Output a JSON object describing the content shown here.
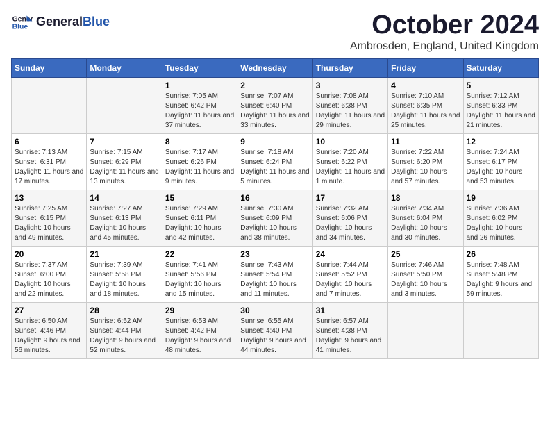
{
  "logo": {
    "line1": "General",
    "line2": "Blue"
  },
  "title": "October 2024",
  "location": "Ambrosden, England, United Kingdom",
  "headers": [
    "Sunday",
    "Monday",
    "Tuesday",
    "Wednesday",
    "Thursday",
    "Friday",
    "Saturday"
  ],
  "weeks": [
    [
      {
        "day": "",
        "info": ""
      },
      {
        "day": "",
        "info": ""
      },
      {
        "day": "1",
        "info": "Sunrise: 7:05 AM\nSunset: 6:42 PM\nDaylight: 11 hours and 37 minutes."
      },
      {
        "day": "2",
        "info": "Sunrise: 7:07 AM\nSunset: 6:40 PM\nDaylight: 11 hours and 33 minutes."
      },
      {
        "day": "3",
        "info": "Sunrise: 7:08 AM\nSunset: 6:38 PM\nDaylight: 11 hours and 29 minutes."
      },
      {
        "day": "4",
        "info": "Sunrise: 7:10 AM\nSunset: 6:35 PM\nDaylight: 11 hours and 25 minutes."
      },
      {
        "day": "5",
        "info": "Sunrise: 7:12 AM\nSunset: 6:33 PM\nDaylight: 11 hours and 21 minutes."
      }
    ],
    [
      {
        "day": "6",
        "info": "Sunrise: 7:13 AM\nSunset: 6:31 PM\nDaylight: 11 hours and 17 minutes."
      },
      {
        "day": "7",
        "info": "Sunrise: 7:15 AM\nSunset: 6:29 PM\nDaylight: 11 hours and 13 minutes."
      },
      {
        "day": "8",
        "info": "Sunrise: 7:17 AM\nSunset: 6:26 PM\nDaylight: 11 hours and 9 minutes."
      },
      {
        "day": "9",
        "info": "Sunrise: 7:18 AM\nSunset: 6:24 PM\nDaylight: 11 hours and 5 minutes."
      },
      {
        "day": "10",
        "info": "Sunrise: 7:20 AM\nSunset: 6:22 PM\nDaylight: 11 hours and 1 minute."
      },
      {
        "day": "11",
        "info": "Sunrise: 7:22 AM\nSunset: 6:20 PM\nDaylight: 10 hours and 57 minutes."
      },
      {
        "day": "12",
        "info": "Sunrise: 7:24 AM\nSunset: 6:17 PM\nDaylight: 10 hours and 53 minutes."
      }
    ],
    [
      {
        "day": "13",
        "info": "Sunrise: 7:25 AM\nSunset: 6:15 PM\nDaylight: 10 hours and 49 minutes."
      },
      {
        "day": "14",
        "info": "Sunrise: 7:27 AM\nSunset: 6:13 PM\nDaylight: 10 hours and 45 minutes."
      },
      {
        "day": "15",
        "info": "Sunrise: 7:29 AM\nSunset: 6:11 PM\nDaylight: 10 hours and 42 minutes."
      },
      {
        "day": "16",
        "info": "Sunrise: 7:30 AM\nSunset: 6:09 PM\nDaylight: 10 hours and 38 minutes."
      },
      {
        "day": "17",
        "info": "Sunrise: 7:32 AM\nSunset: 6:06 PM\nDaylight: 10 hours and 34 minutes."
      },
      {
        "day": "18",
        "info": "Sunrise: 7:34 AM\nSunset: 6:04 PM\nDaylight: 10 hours and 30 minutes."
      },
      {
        "day": "19",
        "info": "Sunrise: 7:36 AM\nSunset: 6:02 PM\nDaylight: 10 hours and 26 minutes."
      }
    ],
    [
      {
        "day": "20",
        "info": "Sunrise: 7:37 AM\nSunset: 6:00 PM\nDaylight: 10 hours and 22 minutes."
      },
      {
        "day": "21",
        "info": "Sunrise: 7:39 AM\nSunset: 5:58 PM\nDaylight: 10 hours and 18 minutes."
      },
      {
        "day": "22",
        "info": "Sunrise: 7:41 AM\nSunset: 5:56 PM\nDaylight: 10 hours and 15 minutes."
      },
      {
        "day": "23",
        "info": "Sunrise: 7:43 AM\nSunset: 5:54 PM\nDaylight: 10 hours and 11 minutes."
      },
      {
        "day": "24",
        "info": "Sunrise: 7:44 AM\nSunset: 5:52 PM\nDaylight: 10 hours and 7 minutes."
      },
      {
        "day": "25",
        "info": "Sunrise: 7:46 AM\nSunset: 5:50 PM\nDaylight: 10 hours and 3 minutes."
      },
      {
        "day": "26",
        "info": "Sunrise: 7:48 AM\nSunset: 5:48 PM\nDaylight: 9 hours and 59 minutes."
      }
    ],
    [
      {
        "day": "27",
        "info": "Sunrise: 6:50 AM\nSunset: 4:46 PM\nDaylight: 9 hours and 56 minutes."
      },
      {
        "day": "28",
        "info": "Sunrise: 6:52 AM\nSunset: 4:44 PM\nDaylight: 9 hours and 52 minutes."
      },
      {
        "day": "29",
        "info": "Sunrise: 6:53 AM\nSunset: 4:42 PM\nDaylight: 9 hours and 48 minutes."
      },
      {
        "day": "30",
        "info": "Sunrise: 6:55 AM\nSunset: 4:40 PM\nDaylight: 9 hours and 44 minutes."
      },
      {
        "day": "31",
        "info": "Sunrise: 6:57 AM\nSunset: 4:38 PM\nDaylight: 9 hours and 41 minutes."
      },
      {
        "day": "",
        "info": ""
      },
      {
        "day": "",
        "info": ""
      }
    ]
  ]
}
